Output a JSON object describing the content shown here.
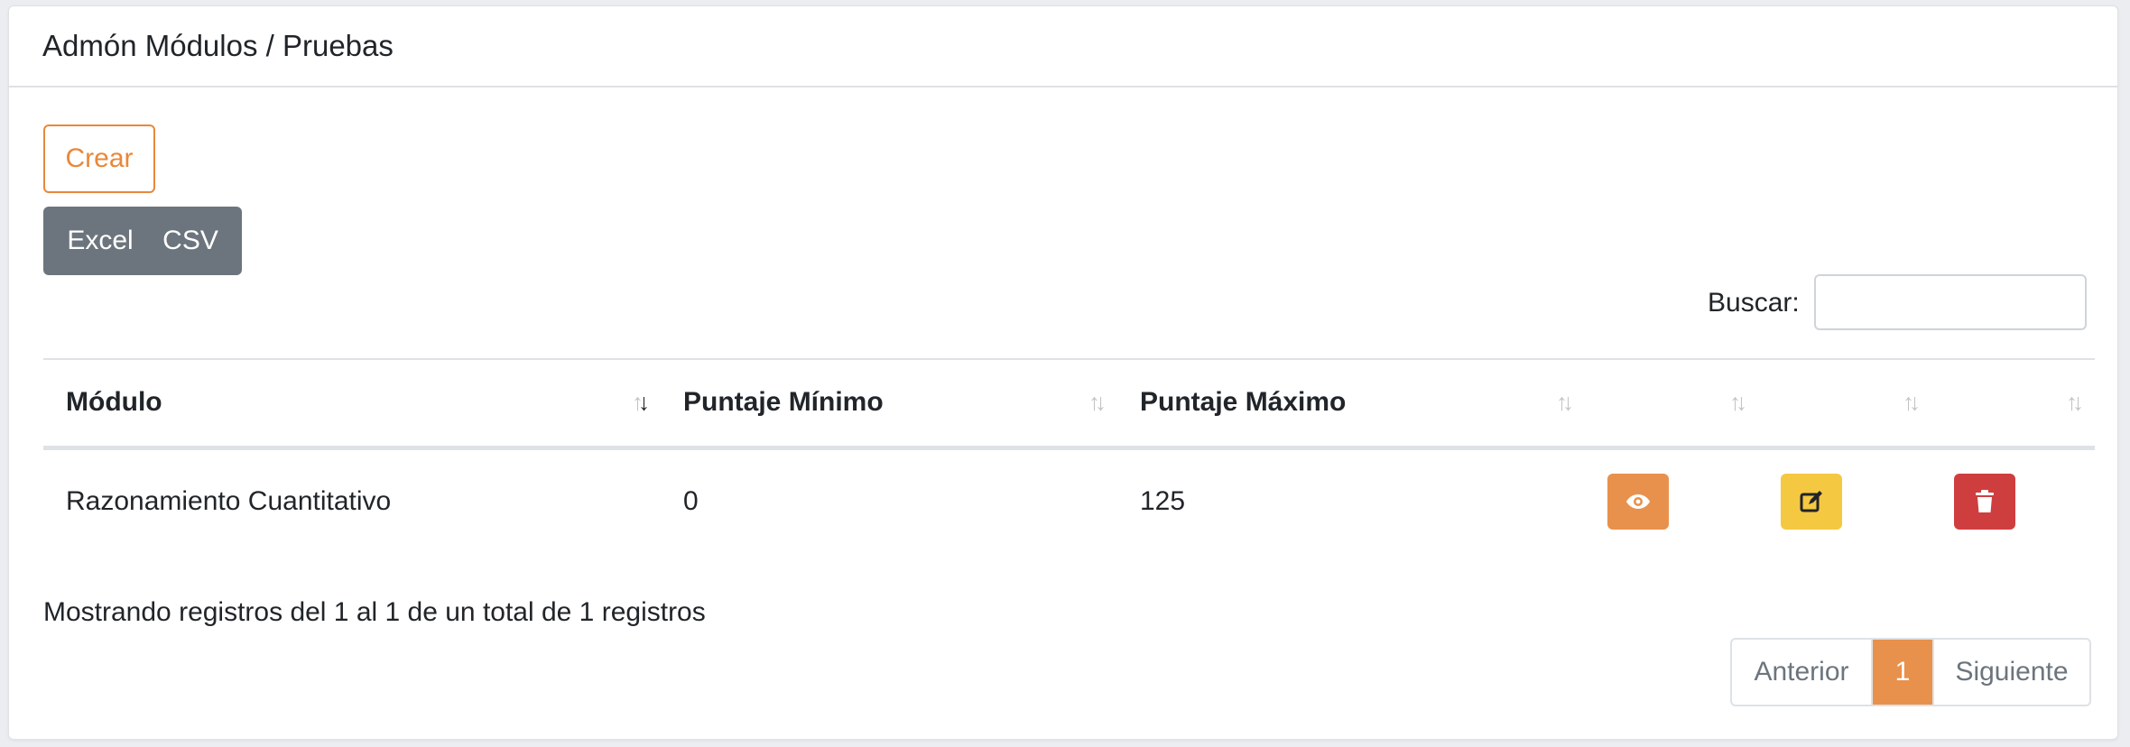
{
  "header": {
    "title": "Admón Módulos / Pruebas"
  },
  "toolbar": {
    "create_label": "Crear",
    "export": {
      "excel_label": "Excel",
      "csv_label": "CSV"
    }
  },
  "search": {
    "label": "Buscar:",
    "value": "",
    "placeholder": ""
  },
  "table": {
    "columns": [
      "Módulo",
      "Puntaje Mínimo",
      "Puntaje Máximo",
      "",
      "",
      ""
    ],
    "sorted_column": "Módulo",
    "sort_direction": "descending-indicator",
    "rows": [
      {
        "modulo": "Razonamiento Cuantitativo",
        "puntaje_minimo": "0",
        "puntaje_maximo": "125",
        "actions": [
          "eye-icon",
          "edit-icon",
          "trash-icon"
        ]
      }
    ]
  },
  "footer": {
    "info": "Mostrando registros del 1 al 1 de un total de 1 registros",
    "pagination": {
      "prev_label": "Anterior",
      "current_page": "1",
      "next_label": "Siguiente"
    }
  },
  "colors": {
    "accent": "#e8883a",
    "view": "#e8914c",
    "edit": "#f5c842",
    "delete": "#cf3e3f",
    "export_group": "#6c757d"
  }
}
